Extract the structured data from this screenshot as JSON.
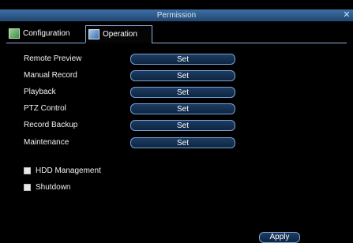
{
  "window": {
    "title": "Permission"
  },
  "tabs": [
    {
      "label": "Configuration",
      "icon": "configuration-icon"
    },
    {
      "label": "Operation",
      "icon": "operation-icon",
      "active": true
    }
  ],
  "operations": [
    {
      "label": "Remote Preview",
      "button": "Set"
    },
    {
      "label": "Manual Record",
      "button": "Set"
    },
    {
      "label": "Playback",
      "button": "Set"
    },
    {
      "label": "PTZ Control",
      "button": "Set"
    },
    {
      "label": "Record Backup",
      "button": "Set"
    },
    {
      "label": "Maintenance",
      "button": "Set"
    }
  ],
  "checkboxes": [
    {
      "label": "HDD Management",
      "checked": false
    },
    {
      "label": "Shutdown",
      "checked": false
    }
  ],
  "actions": {
    "apply": "Apply"
  },
  "colors": {
    "accent": "#7aa2d4",
    "titlebar": "#2f5b8c",
    "background": "#000000"
  }
}
